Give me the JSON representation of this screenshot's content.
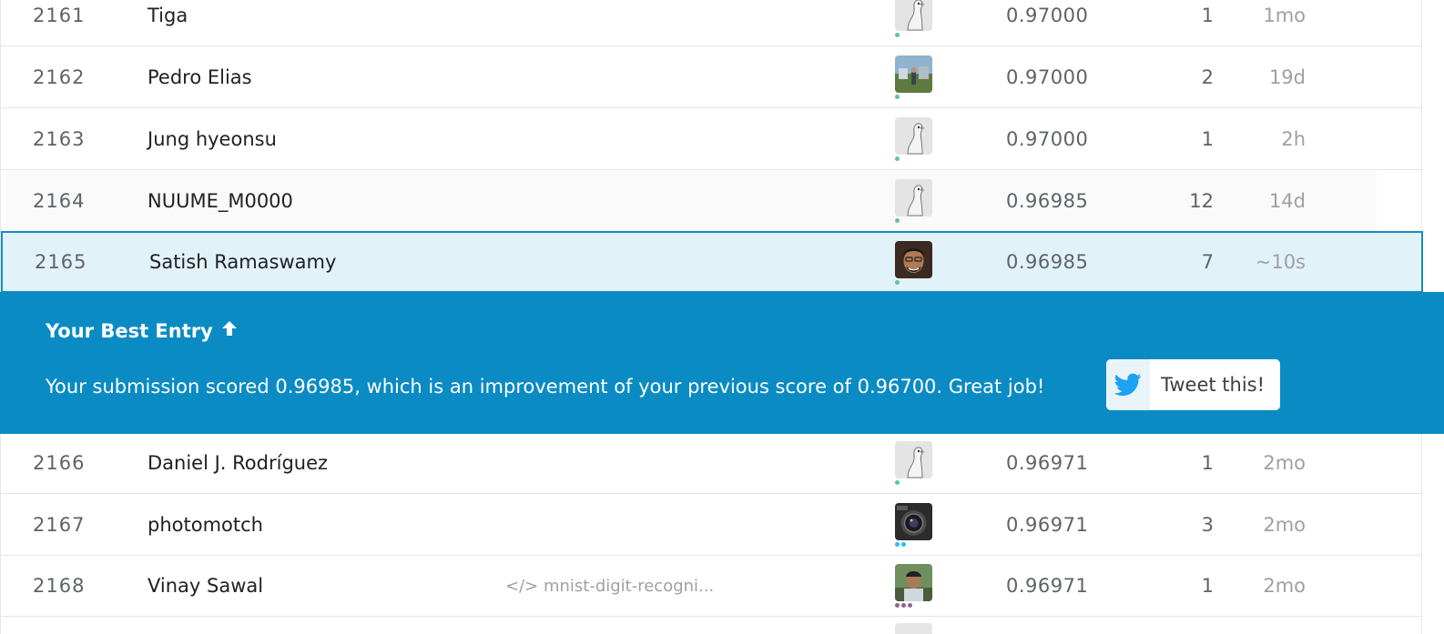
{
  "rows_top": [
    {
      "rank": "2161",
      "name": "Tiga",
      "kernel": "",
      "score": "0.97000",
      "entries": "1",
      "last": "1mo",
      "avatar": "goose-avatar-icon",
      "tier": "novice"
    },
    {
      "rank": "2162",
      "name": "Pedro Elias",
      "kernel": "",
      "score": "0.97000",
      "entries": "2",
      "last": "19d",
      "avatar": "photo-avatar-icon",
      "tier": "novice"
    },
    {
      "rank": "2163",
      "name": "Jung hyeonsu",
      "kernel": "",
      "score": "0.97000",
      "entries": "1",
      "last": "2h",
      "avatar": "goose-avatar-icon",
      "tier": "novice"
    },
    {
      "rank": "2164",
      "name": "NUUME_M0000",
      "kernel": "",
      "score": "0.96985",
      "entries": "12",
      "last": "14d",
      "avatar": "goose-avatar-icon",
      "tier": "novice"
    }
  ],
  "my_row": {
    "rank": "2165",
    "name": "Satish Ramaswamy",
    "kernel": "",
    "score": "0.96985",
    "entries": "7",
    "last": "~10s",
    "avatar": "photo-avatar-icon",
    "tier": "novice"
  },
  "banner": {
    "title": "Your Best Entry",
    "message": "Your submission scored 0.96985, which is an improvement of your previous score of 0.96700. Great job!",
    "tweet_label": "Tweet this!"
  },
  "rows_bottom": [
    {
      "rank": "2166",
      "name": "Daniel J. Rodríguez",
      "kernel": "",
      "score": "0.96971",
      "entries": "1",
      "last": "2mo",
      "avatar": "goose-avatar-icon",
      "tier": "novice"
    },
    {
      "rank": "2167",
      "name": "photomotch",
      "kernel": "",
      "score": "0.96971",
      "entries": "3",
      "last": "2mo",
      "avatar": "camera-avatar-icon",
      "tier": "contributor"
    },
    {
      "rank": "2168",
      "name": "Vinay Sawal",
      "kernel": "</> mnist-digit-recogni...",
      "score": "0.96971",
      "entries": "1",
      "last": "2mo",
      "avatar": "photo-avatar-icon",
      "tier": "expert"
    }
  ],
  "colors": {
    "accent": "#0a8bc4",
    "highlight_row": "#e2f2f9",
    "tier_novice": "#5ac995",
    "tier_contributor": "#20beff",
    "tier_expert": "#95628f"
  }
}
